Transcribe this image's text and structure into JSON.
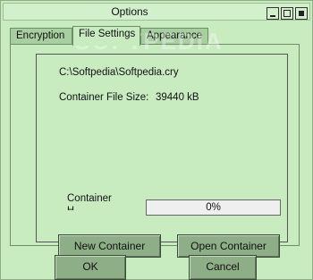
{
  "window": {
    "title": "Options"
  },
  "tabs": [
    {
      "label": "Encryption",
      "active": false
    },
    {
      "label": "File Settings",
      "active": true
    },
    {
      "label": "Appearance",
      "active": false
    }
  ],
  "file_settings": {
    "file_path": "C:\\Softpedia\\Softpedia.cry",
    "size_label": "Container File Size:",
    "size_value": "39440 kB",
    "progress_label": "Container",
    "progress_label_cont": "H",
    "progress_value": 0,
    "progress_text": "0%",
    "new_container_button": "New Container",
    "open_container_button": "Open Container"
  },
  "footer": {
    "ok_button": "OK",
    "cancel_button": "Cancel"
  },
  "watermark": "SOFTPEDIA",
  "colors": {
    "background": "#c8ecc0",
    "tab_inactive": "#a8cfa0",
    "button": "#8dae86"
  }
}
